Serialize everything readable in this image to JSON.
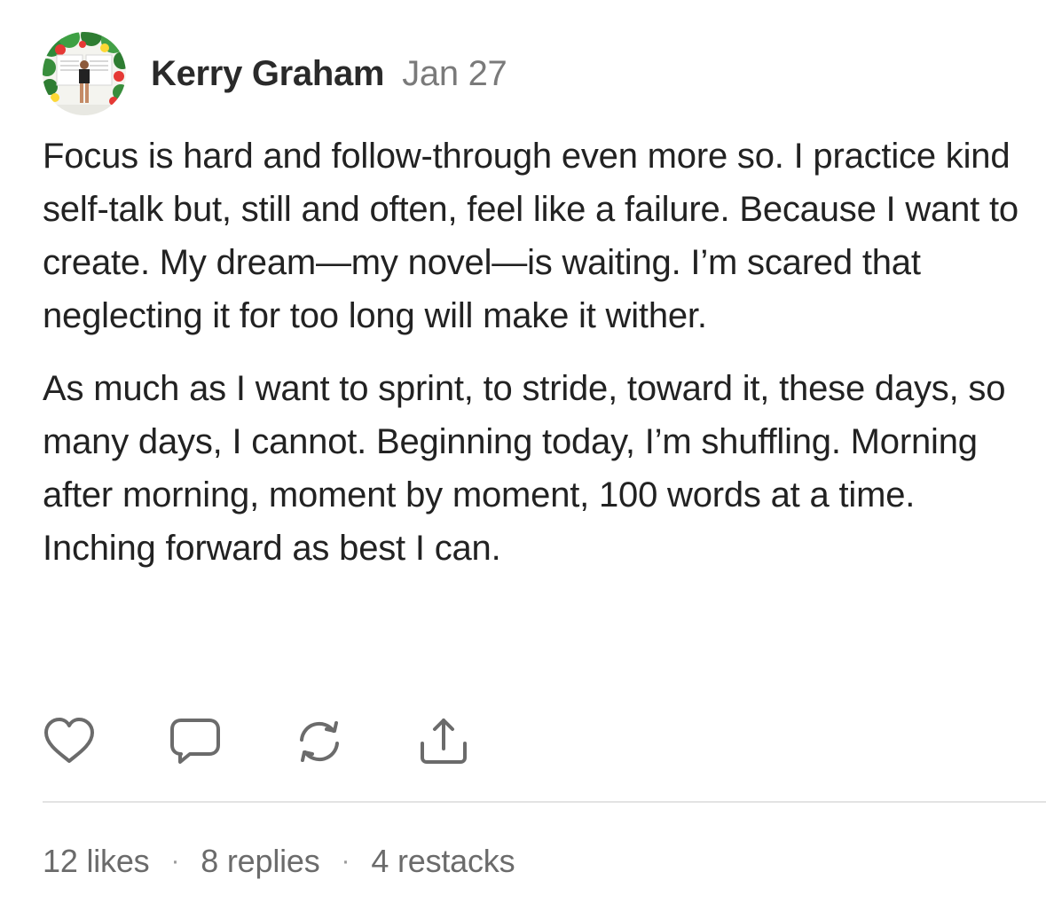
{
  "post": {
    "author": "Kerry Graham",
    "date": "Jan 27",
    "avatar_icon": "profile-photo",
    "paragraphs": [
      "Focus is hard and follow-through even more so. I practice kind self-talk but, still and often, feel like a failure. Because I want to create. My dream—my novel—is waiting. I’m scared that neglecting it for too long will make it wither.",
      "As much as I want to sprint, to stride, toward it, these days, so many days, I cannot. Beginning today, I’m shuffling. Morning after morning, moment by moment, 100 words at a time. Inching forward as best I can."
    ]
  },
  "actions": {
    "like_icon": "heart-icon",
    "reply_icon": "comment-icon",
    "restack_icon": "restack-icon",
    "share_icon": "share-icon",
    "icon_color": "#6b6b6b"
  },
  "stats": {
    "likes": "12 likes",
    "separator": "·",
    "replies": "8 replies",
    "restacks": "4 restacks"
  }
}
